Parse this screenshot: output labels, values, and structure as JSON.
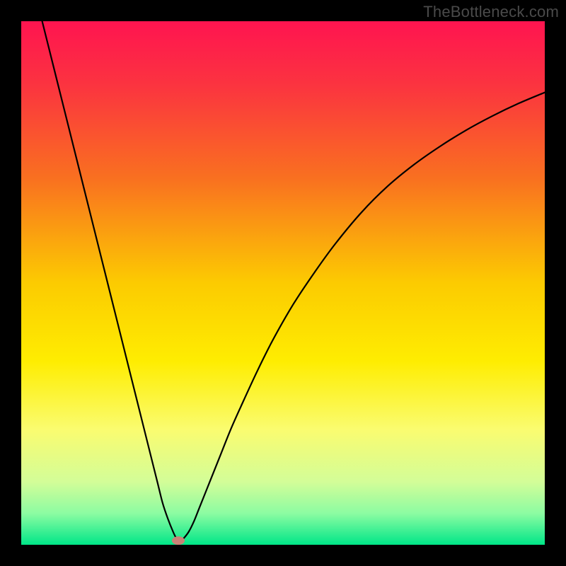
{
  "watermark": "TheBottleneck.com",
  "chart_data": {
    "type": "line",
    "title": "",
    "xlabel": "",
    "ylabel": "",
    "xlim": [
      0,
      100
    ],
    "ylim": [
      0,
      100
    ],
    "background_gradient": {
      "stops": [
        {
          "offset": 0.0,
          "color": "#ff1450"
        },
        {
          "offset": 0.12,
          "color": "#fb3340"
        },
        {
          "offset": 0.3,
          "color": "#f97020"
        },
        {
          "offset": 0.5,
          "color": "#fccb01"
        },
        {
          "offset": 0.65,
          "color": "#feed01"
        },
        {
          "offset": 0.78,
          "color": "#fafc70"
        },
        {
          "offset": 0.88,
          "color": "#d3fd98"
        },
        {
          "offset": 0.94,
          "color": "#8cfca2"
        },
        {
          "offset": 1.0,
          "color": "#00e688"
        }
      ]
    },
    "series": [
      {
        "name": "bottleneck-curve",
        "color": "#000000",
        "width": 2.2,
        "x": [
          4,
          6,
          8,
          10,
          12,
          14,
          16,
          18,
          20,
          22,
          24,
          26,
          27,
          28,
          29,
          29.6,
          30.3,
          31,
          32,
          33,
          34,
          36,
          38,
          40,
          42,
          45,
          48,
          52,
          56,
          60,
          65,
          70,
          75,
          80,
          85,
          90,
          95,
          100
        ],
        "y": [
          100,
          92,
          84,
          76,
          68,
          60,
          52,
          44,
          36,
          28,
          20,
          12,
          8,
          5,
          2.5,
          1.3,
          0.6,
          1.2,
          2.5,
          4.5,
          7,
          12,
          17,
          22,
          26.5,
          33,
          39,
          46,
          52,
          57.5,
          63.5,
          68.5,
          72.6,
          76.1,
          79.2,
          81.9,
          84.3,
          86.4
        ]
      }
    ],
    "marker": {
      "x": 30,
      "y": 0.8,
      "color": "#c98276",
      "rx": 9,
      "ry": 6
    }
  }
}
